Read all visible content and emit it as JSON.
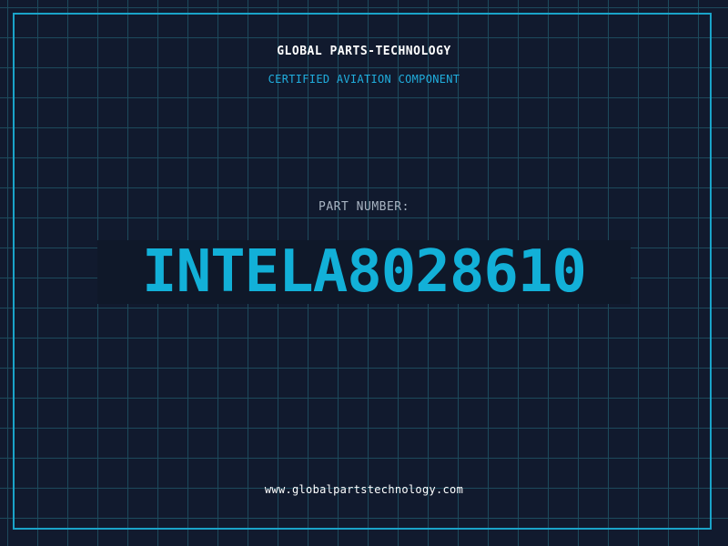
{
  "header": {
    "company": "GLOBAL PARTS-TECHNOLOGY",
    "tagline": "CERTIFIED AVIATION COMPONENT"
  },
  "part": {
    "label": "PART NUMBER:",
    "number": "INTELA8028610"
  },
  "footer": {
    "url": "www.globalpartstechnology.com"
  },
  "colors": {
    "background": "#111a2e",
    "grid": "#1d4a5c",
    "accent": "#12b0d8",
    "frame": "#1aa3c8"
  }
}
